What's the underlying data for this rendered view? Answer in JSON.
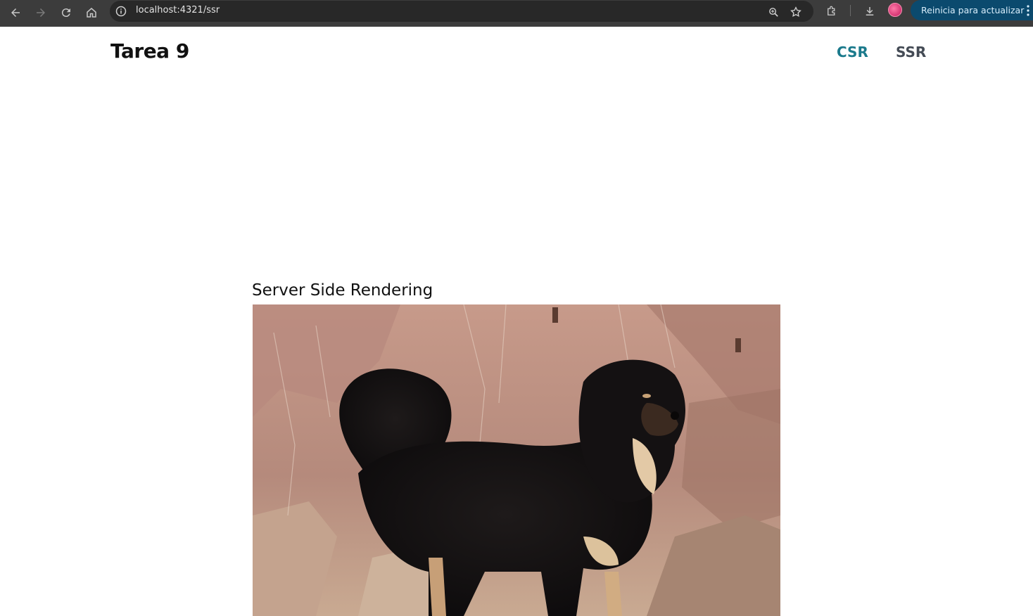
{
  "browser": {
    "url": "localhost:4321/ssr",
    "update_button_label": "Reinicia para actualizar"
  },
  "site": {
    "title": "Tarea 9",
    "nav": [
      {
        "label": "CSR",
        "color": "#1b7a8c"
      },
      {
        "label": "SSR",
        "color": "#444b55"
      }
    ]
  },
  "main": {
    "heading": "Server Side Rendering",
    "image_subject": "black-and-tan-long-haired-dog"
  },
  "colors": {
    "chrome_bg": "#3c3c3c",
    "omnibox_bg": "#282828",
    "update_button_bg": "#0b4a6e",
    "active_link": "#1b7a8c"
  }
}
